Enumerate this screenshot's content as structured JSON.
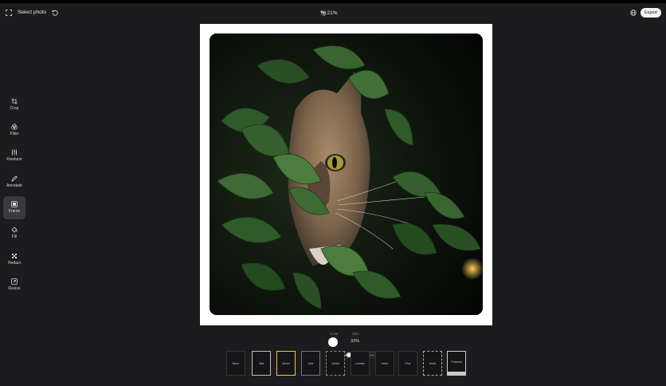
{
  "topbar": {
    "select_photo": "Select photo",
    "zoom_value": "21%",
    "export_label": "Export"
  },
  "sidebar": {
    "items": [
      {
        "label": "Crop",
        "icon": "crop-icon"
      },
      {
        "label": "Filter",
        "icon": "filter-icon"
      },
      {
        "label": "Finetune",
        "icon": "finetune-icon"
      },
      {
        "label": "Annotate",
        "icon": "annotate-icon"
      },
      {
        "label": "Frame",
        "icon": "frame-icon",
        "active": true
      },
      {
        "label": "Fill",
        "icon": "fill-icon"
      },
      {
        "label": "Redact",
        "icon": "redact-icon"
      },
      {
        "label": "Resize",
        "icon": "resize-icon"
      }
    ]
  },
  "controls": {
    "color_label": "Color",
    "size_label": "Size",
    "size_value": "33%",
    "slider_minus": "-",
    "slider_plus": "+",
    "slider_level": 0.33
  },
  "frame_styles": [
    {
      "label": "None"
    },
    {
      "label": "Mat"
    },
    {
      "label": "Bevel",
      "selected": true
    },
    {
      "label": "Line"
    },
    {
      "label": "Zebra"
    },
    {
      "label": "Lumber"
    },
    {
      "label": "Inset"
    },
    {
      "label": "Plus"
    },
    {
      "label": "Hook"
    },
    {
      "label": "Polaroid"
    }
  ],
  "colors": {
    "background": "#1c1c1e",
    "active_item": "#3a3a3e",
    "selected_frame": "#e8c94a",
    "frame_white": "#ffffff"
  }
}
